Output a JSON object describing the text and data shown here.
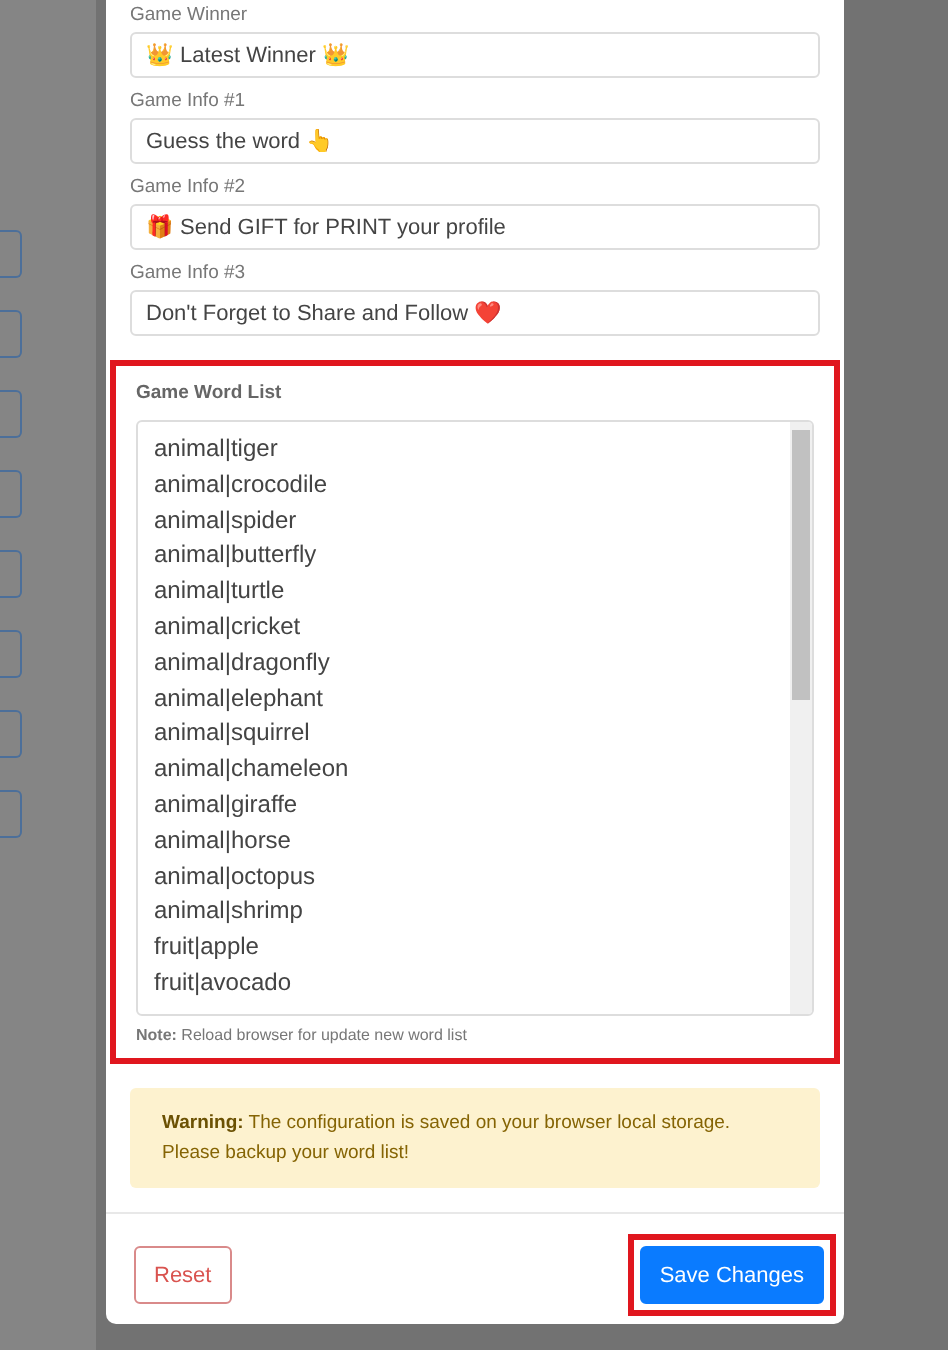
{
  "fields": [
    {
      "label": "Game Winner",
      "value": "👑 Latest Winner 👑"
    },
    {
      "label": "Game Info #1",
      "value": "Guess the word 👆"
    },
    {
      "label": "Game Info #2",
      "value": "🎁 Send GIFT for PRINT your profile"
    },
    {
      "label": "Game Info #3",
      "value": "Don't Forget to Share and Follow ❤️"
    }
  ],
  "word_list": {
    "label": "Game Word List",
    "highlighted": true,
    "words": [
      "animal|tiger",
      "animal|crocodile",
      "animal|spider",
      "animal|butterfly",
      "animal|turtle",
      "animal|cricket",
      "animal|dragonfly",
      "animal|elephant",
      "animal|squirrel",
      "animal|chameleon",
      "animal|giraffe",
      "animal|horse",
      "animal|octopus",
      "animal|shrimp",
      "fruit|apple",
      "fruit|avocado"
    ],
    "note": "**Note:** Reload browser for update new word list"
  },
  "warning": "**Warning:** The configuration is saved on your browser local storage. Please backup your word list!",
  "buttons": [
    {
      "label": "Reset",
      "kind": "outline",
      "highlighted": false
    },
    {
      "label": "Save Changes",
      "kind": "primary",
      "highlighted": true
    }
  ]
}
